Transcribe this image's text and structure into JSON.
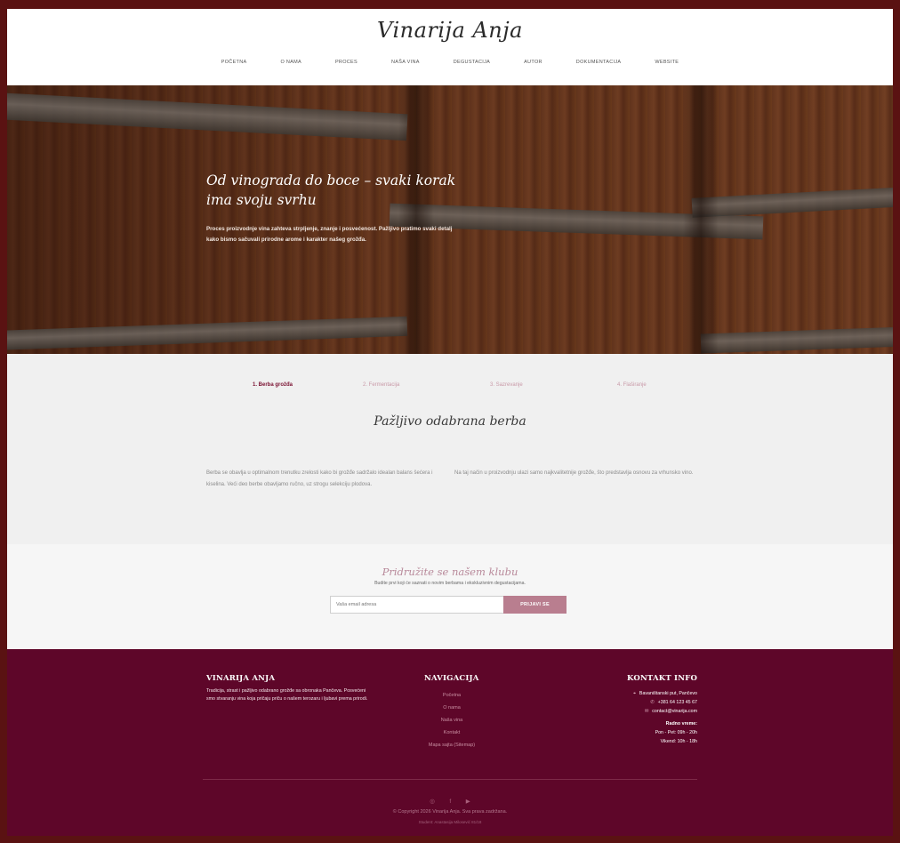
{
  "header": {
    "logo": "Vinarija Anja",
    "nav": [
      "POČETNA",
      "O NAMA",
      "PROCES",
      "NAŠA VINA",
      "DEGUSTACIJA",
      "AUTOR",
      "DOKUMENTACIJA",
      "WEBSITE"
    ]
  },
  "hero": {
    "title": "Od vinograda do boce – svaki korak ima svoju svrhu",
    "text": "Proces proizvodnje vina zahteva strpljenje, znanje i posvećenost. Pažljivo pratimo svaki detalj kako bismo sačuvali prirodne arome i karakter našeg grožđa."
  },
  "process": {
    "tabs": [
      "1. Berba grožđa",
      "2. Fermentacija",
      "3. Sazrevanje",
      "4. Flaširanje"
    ],
    "active_tab": 0,
    "title": "Pažljivo odabrana berba",
    "col1": "Berba se obavlja u optimalnom trenutku zrelosti kako bi grožđe sadržalo idealan balans šećera i kiselina. Veći deo berbe obavljamo ručno, uz strogu selekciju plodova.",
    "col2": "Na taj način u proizvodnju ulazi samo najkvalitetnije grožđe, što predstavlja osnovu za vrhunsko vino."
  },
  "newsletter": {
    "title": "Pridružite se našem klubu",
    "subtitle": "Budite prvi koji će saznati o novim berbama i ekskluzivnim degustacijama.",
    "placeholder": "Vaša email adresa",
    "button": "PRIJAVI SE"
  },
  "footer": {
    "about_title": "VINARIJA ANJA",
    "about_text": "Tradicija, strast i pažljivo odabrano grožđe sa obronaka Pančeva. Posvećeni smo stvaranju vina koja pričaju priču o našem terozaru i ljubavi prema prirodi.",
    "nav_title": "NAVIGACIJA",
    "nav_items": [
      "Početna",
      "O nama",
      "Naša vina",
      "Kontakt",
      "Mapa sajta (Sitemap)"
    ],
    "contact_title": "KONTAKT INFO",
    "address": "Bavaništanski put, Pančevo",
    "phone": "+381 64 123 45 67",
    "email": "contact@vinarija.com",
    "hours_label": "Radno vreme:",
    "hours_weekdays": "Pon - Pet: 09h - 20h",
    "hours_weekend": "Vikend: 10h - 18h",
    "social": [
      "instagram-icon",
      "facebook-icon",
      "youtube-icon"
    ],
    "copyright": "© Copyright 2026 Vinarija Anja. Sva prava zadržana.",
    "student": "Student: Anastasija Milosević 81/18"
  }
}
